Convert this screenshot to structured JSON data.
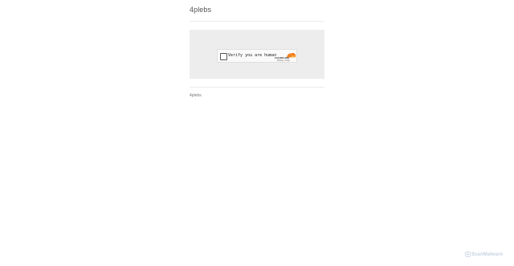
{
  "header": {
    "title": "4plebs"
  },
  "challenge": {
    "label": "Verify you are human",
    "provider_wordmark": "CLOUDFLARE",
    "links": [
      "Privacy",
      "Help"
    ],
    "link_separator": "•"
  },
  "footer": {
    "text": "4plebs"
  },
  "watermark": {
    "text": "ScanMalware"
  },
  "icons": [
    "checkbox-icon",
    "cloudflare-logo-icon",
    "scanmalware-icon"
  ],
  "colors": {
    "cloudflare_orange": "#f38020",
    "cloudflare_yellow": "#faad3f",
    "challenge_bg": "#ededed"
  }
}
